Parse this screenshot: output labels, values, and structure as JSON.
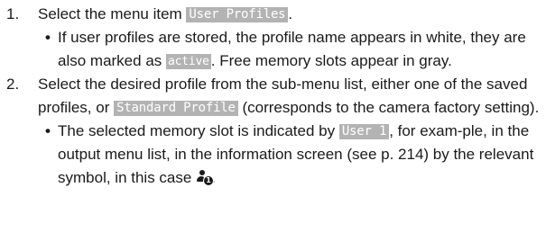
{
  "steps": [
    {
      "number": "1.",
      "pre": "Select the menu item ",
      "tag": "User Profiles",
      "post": ".",
      "bullets": [
        {
          "t1": "If user profiles are stored, the profile name appears in white, they are also marked as ",
          "tag": "active",
          "t2": ". Free memory slots appear in gray."
        }
      ]
    },
    {
      "number": "2.",
      "pre": "Select the desired profile from the sub-menu list, either one of the saved profiles, or ",
      "tag": "Standard Profile",
      "post": " (corresponds to the camera factory setting).",
      "bullets": [
        {
          "t1": "The selected memory slot is indicated by ",
          "tag": "User 1",
          "t2": ", for exam-ple, in the output menu list, in the information screen (see p. 214) by the relevant symbol, in this case ",
          "symbol_badge": "1",
          "t3": "."
        }
      ]
    }
  ],
  "colors": {
    "text": "#1a1a1a",
    "tag_background": "#b3b3b3",
    "tag_text": "#ffffff"
  },
  "icons": {
    "profile_symbol": "user-profile-1-icon"
  }
}
